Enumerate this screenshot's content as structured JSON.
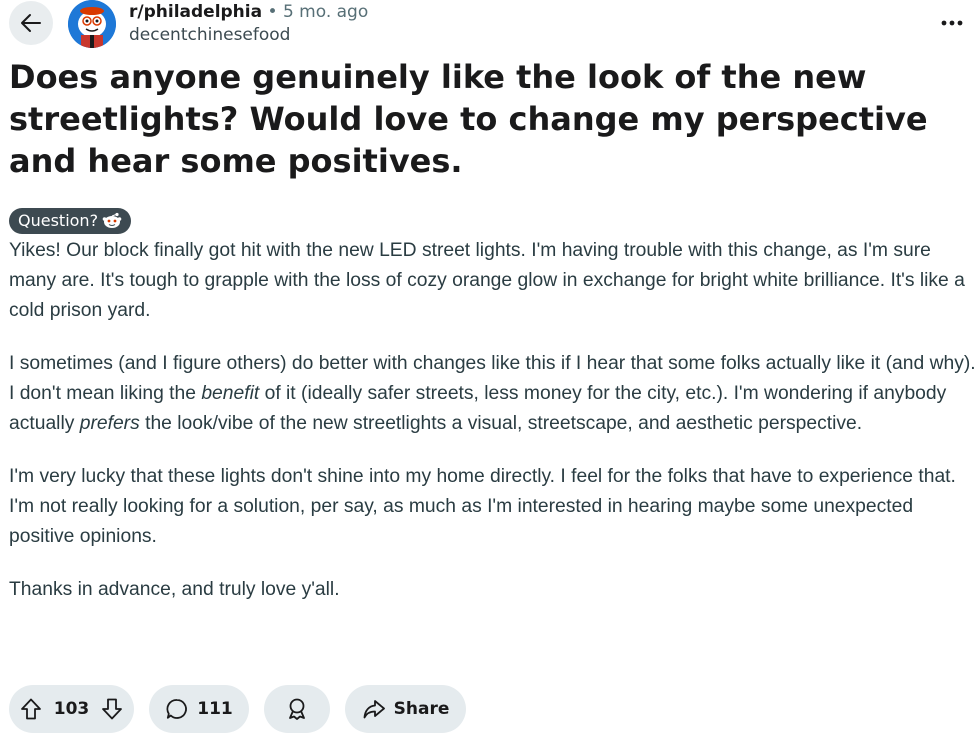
{
  "post": {
    "subreddit": "r/philadelphia",
    "separator": "•",
    "age": "5 mo. ago",
    "author": "decentchinesefood",
    "title": "Does anyone genuinely like the look of the new streetlights? Would love to change my perspective and hear some positives.",
    "flair": "Question?",
    "flair_icon": "snoo-icon",
    "body": {
      "p1": "Yikes! Our block finally got hit with the new LED street lights. I'm having trouble with this change, as I'm sure many are. It's tough to grapple with the loss of cozy orange glow in exchange for bright white brilliance. It's like a cold prison yard.",
      "p2_a": "I sometimes (and I figure others) do better with changes like this if I hear that some folks actually like it (and why). I don't mean liking the ",
      "p2_em1": "benefit",
      "p2_b": " of it (ideally safer streets, less money for the city, etc.). I'm wondering if anybody actually ",
      "p2_em2": "prefers",
      "p2_c": " the look/vibe of the new streetlights a visual, streetscape, and aesthetic perspective.",
      "p3": "I'm very lucky that these lights don't shine into my home directly. I feel for the folks that have to experience that. I'm not really looking for a solution, per say, as much as I'm interested in hearing maybe some unexpected positive opinions.",
      "p4": "Thanks in advance, and truly love y'all."
    }
  },
  "actions": {
    "votes": "103",
    "comments": "111",
    "share_label": "Share"
  },
  "icons": {
    "back": "arrow-left-icon",
    "more": "ellipsis-horizontal-icon",
    "upvote": "arrow-up-icon",
    "downvote": "arrow-down-icon",
    "comment": "speech-bubble-icon",
    "award": "award-ribbon-icon",
    "share": "share-arrow-icon"
  },
  "colors": {
    "pill_background": "#e5ebee",
    "flair_background": "#3d4a51",
    "avatar_background": "#1e78d7"
  }
}
